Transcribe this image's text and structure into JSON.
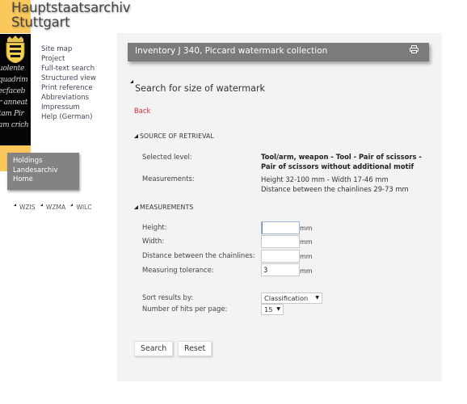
{
  "site": {
    "title_line1": "Hauptstaatsarchiv",
    "title_line2": "Stuttgart",
    "brand_yellow": "#fcc85c",
    "script_lines": [
      "uolente",
      "quadrim",
      "ecfaceb",
      "r anneat",
      "tam Pir",
      "am crich"
    ]
  },
  "nav": {
    "items": [
      {
        "label": "Site map"
      },
      {
        "label": "Project"
      },
      {
        "label": "Full-text search"
      },
      {
        "label": "Structured view"
      },
      {
        "label": "Print reference"
      },
      {
        "label": "Abbreviations"
      },
      {
        "label": "Impressum"
      },
      {
        "label": "Help (German)"
      }
    ]
  },
  "holdings": {
    "items": [
      {
        "label": "Holdings"
      },
      {
        "label": "Landesarchiv"
      },
      {
        "label": "Home"
      }
    ]
  },
  "databases": {
    "items": [
      {
        "label": "WZIS"
      },
      {
        "label": "WZMA"
      },
      {
        "label": "WILC"
      }
    ]
  },
  "panel": {
    "title": "Inventory J 340, Piccard watermark collection",
    "print_icon": "printer-icon",
    "heading": "Search for size of watermark",
    "back_label": "Back",
    "link_color": "#d62b3a"
  },
  "source": {
    "header": "SOURCE OF RETRIEVAL",
    "selected_level_label": "Selected level:",
    "selected_level_line1": "Tool/arm, weapon - Tool - Pair of scissors -",
    "selected_level_line2": "Pair of scissors without additional motif",
    "measurements_label": "Measurements:",
    "measurements_line1": "Height 32-100 mm - Width 17-46 mm",
    "measurements_line2": "Distance between the chainlines 29-73 mm"
  },
  "measurements": {
    "header": "MEASUREMENTS",
    "fields": [
      {
        "label": "Height:",
        "value": "",
        "unit": "mm"
      },
      {
        "label": "Width:",
        "value": "",
        "unit": "mm"
      },
      {
        "label": "Distance between the chainlines:",
        "value": "",
        "unit": "mm"
      },
      {
        "label": "Measuring tolerance:",
        "value": "3",
        "unit": "mm"
      }
    ],
    "sort_label": "Sort results by:",
    "sort_value": "Classification",
    "hits_label": "Number of hits per page:",
    "hits_value": "15"
  },
  "actions": {
    "search_label": "Search",
    "reset_label": "Reset"
  }
}
